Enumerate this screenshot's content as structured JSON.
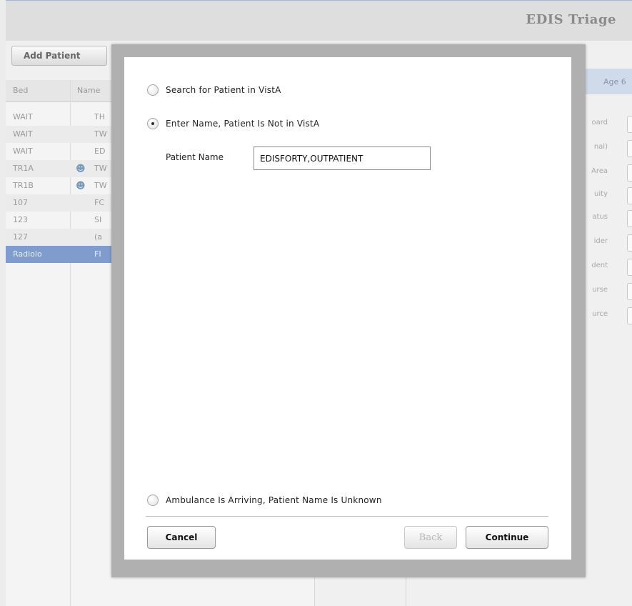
{
  "app": {
    "title": "EDIS Triage"
  },
  "toolbar": {
    "add_patient_label": "Add Patient"
  },
  "grid": {
    "headers": {
      "bed": "Bed",
      "name": "Name"
    },
    "rows": [
      {
        "bed": "WAIT",
        "name": "TH"
      },
      {
        "bed": "WAIT",
        "name": "TW"
      },
      {
        "bed": "WAIT",
        "name": "ED"
      },
      {
        "bed": "TR1A",
        "name": "TW"
      },
      {
        "bed": "TR1B",
        "name": "TW"
      },
      {
        "bed": "107",
        "name": "FC"
      },
      {
        "bed": "123",
        "name": "SI"
      },
      {
        "bed": "127",
        "name": "(a"
      },
      {
        "bed": "Radiolo",
        "name": "FI"
      }
    ]
  },
  "right_panel": {
    "age_label": "Age 6",
    "labels": [
      "oard",
      "nal)",
      "Area",
      "uity",
      "atus",
      "ider",
      "dent",
      "urse",
      "urce"
    ]
  },
  "dialog": {
    "option_search": "Search for Patient in VistA",
    "option_enter_name": "Enter Name, Patient Is Not in VistA",
    "patient_name_label": "Patient Name",
    "patient_name_value": "EDISFORTY,OUTPATIENT",
    "option_ambulance": "Ambulance Is Arriving, Patient Name Is Unknown",
    "cancel_label": "Cancel",
    "back_label": "Back",
    "continue_label": "Continue"
  },
  "colors": {
    "selected_row": "#7f9ccc",
    "header_panel": "#cfdaea",
    "modal_frame": "#b0b0b0"
  },
  "icons": {
    "patient_icon": "people-icon"
  }
}
